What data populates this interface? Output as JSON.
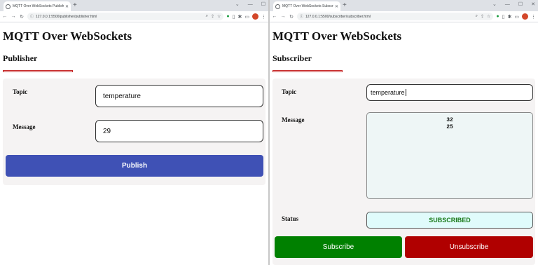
{
  "publisher_window": {
    "tab_title": "MQTT Over WebSockets Publish...",
    "url": "127.0.0.1:5500/publisher/publisher.html",
    "heading": "MQTT Over WebSockets",
    "subheading": "Publisher",
    "topic_label": "Topic",
    "topic_value": "temperature",
    "message_label": "Message",
    "message_value": "29",
    "publish_label": "Publish"
  },
  "subscriber_window": {
    "tab_title": "MQTT Over WebSockets Subscri...",
    "url": "127.0.0.1:5500/subscriber/subscriber.html",
    "heading": "MQTT Over WebSockets",
    "subheading": "Subscriber",
    "topic_label": "Topic",
    "topic_value": "temperature",
    "message_label": "Message",
    "messages": [
      "32",
      "25"
    ],
    "status_label": "Status",
    "status_value": "SUBSCRIBED",
    "subscribe_label": "Subscribe",
    "unsubscribe_label": "Unsubscribe"
  },
  "colors": {
    "publish_button": "#3f51b5",
    "subscribe_button": "#008000",
    "unsubscribe_button": "#b00000",
    "accent_underline": "#c62828",
    "status_text": "#1a7a1a"
  }
}
